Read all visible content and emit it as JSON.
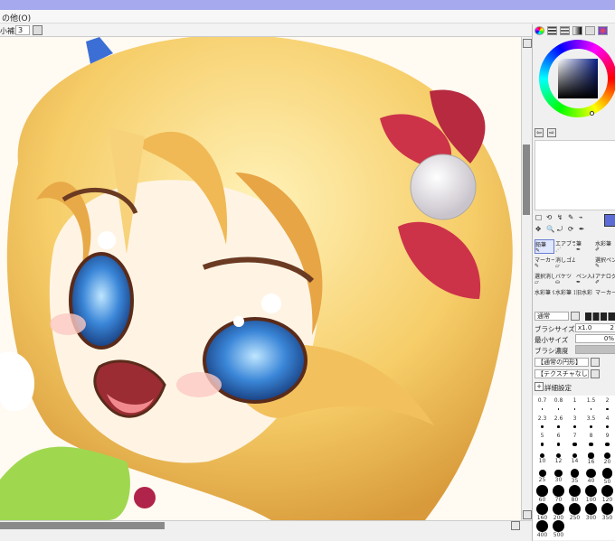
{
  "menu": {
    "label": "の他(O)"
  },
  "tool_options": {
    "label": "小補正",
    "value": "3"
  },
  "colors": {
    "accent": "#a6a9ee",
    "hue_box": "#0a1f86"
  },
  "navigator_buttons": [
    "⇦",
    "⇨"
  ],
  "tools_row1": [
    "□",
    "⟲",
    "↯",
    "✎",
    "⌁"
  ],
  "tools_row2": [
    "✥",
    "🔍",
    "⤾",
    "⟳",
    "✒"
  ],
  "brushes": [
    [
      "鉛筆",
      "エアブラシ",
      "筆",
      "水彩筆"
    ],
    [
      "マーカー",
      "消しゴム",
      "",
      "選択ペン"
    ],
    [
      "選択消し",
      "バケツ",
      "ペン入れ",
      "アナログ"
    ],
    [
      "水彩筆 9級",
      "水彩筆 10級",
      "旧水彩",
      "マーカー"
    ]
  ],
  "blend_mode": "通常",
  "brush_size": {
    "label": "ブラシサイズ",
    "multiplier": "x1.0",
    "value": "2"
  },
  "min_size": {
    "label": "最小サイズ",
    "value": "0%"
  },
  "density": {
    "label": "ブラシ濃度"
  },
  "shape_select": "【通常の円形】",
  "texture_select": "【テクスチャなし】",
  "detail_settings": "詳細設定",
  "size_presets": [
    "0.7",
    "0.8",
    "1",
    "1.5",
    "2",
    "2.3",
    "2.6",
    "3",
    "3.5",
    "4",
    "5",
    "6",
    "7",
    "8",
    "9",
    "10",
    "12",
    "14",
    "16",
    "20",
    "25",
    "30",
    "35",
    "40",
    "50",
    "60",
    "70",
    "80",
    "100",
    "120",
    "160",
    "200",
    "250",
    "300",
    "350",
    "400",
    "500"
  ]
}
